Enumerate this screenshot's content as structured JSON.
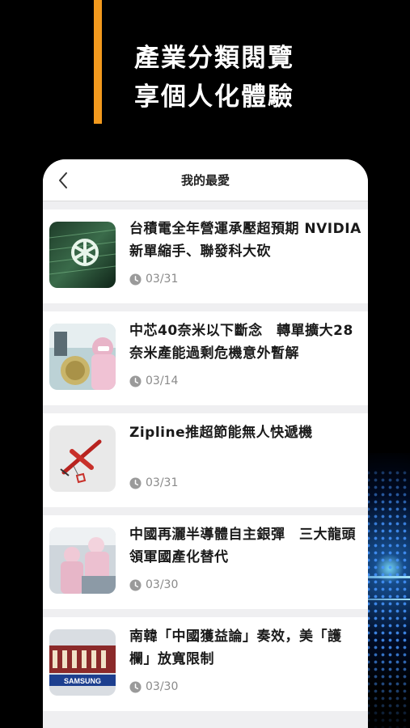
{
  "headline": {
    "line1": "產業分類閱覽",
    "line2": "享個人化體驗"
  },
  "nav": {
    "title": "我的最愛"
  },
  "articles": [
    {
      "title": "台積電全年營運承壓超預期 NVIDIA新單縮手、聯發科大砍",
      "date": "03/31"
    },
    {
      "title": "中芯40奈米以下斷念　轉單擴大28奈米產能過剩危機意外暫解",
      "date": "03/14"
    },
    {
      "title": "Zipline推超節能無人快遞機",
      "date": "03/31"
    },
    {
      "title": "中國再灑半導體自主銀彈　三大龍頭領軍國產化替代",
      "date": "03/30"
    },
    {
      "title": "南韓「中國獲益論」奏效，美「護欄」放寬限制",
      "date": "03/30"
    }
  ],
  "thumb_text": {
    "samsung": "SAMSUNG"
  },
  "colors": {
    "accent": "#f39a1e",
    "background": "#000000",
    "card": "#ffffff",
    "list_bg": "#efeff1",
    "date_text": "#8a8a8a"
  }
}
